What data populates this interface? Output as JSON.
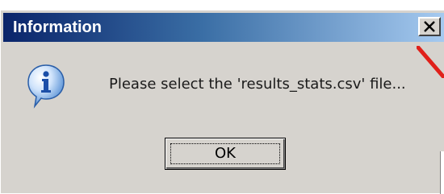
{
  "window": {
    "title": "Information",
    "close_symbol": "X"
  },
  "dialog": {
    "icon": "information-icon",
    "message": "Please select the 'results_stats.csv' file...",
    "ok_label": "OK"
  },
  "colors": {
    "titlebar_start": "#0a246a",
    "titlebar_end": "#a6caf0",
    "dialog_bg": "#d6d3ce",
    "annotation_arrow": "#e0201a",
    "icon_blue": "#2a6fd0"
  }
}
